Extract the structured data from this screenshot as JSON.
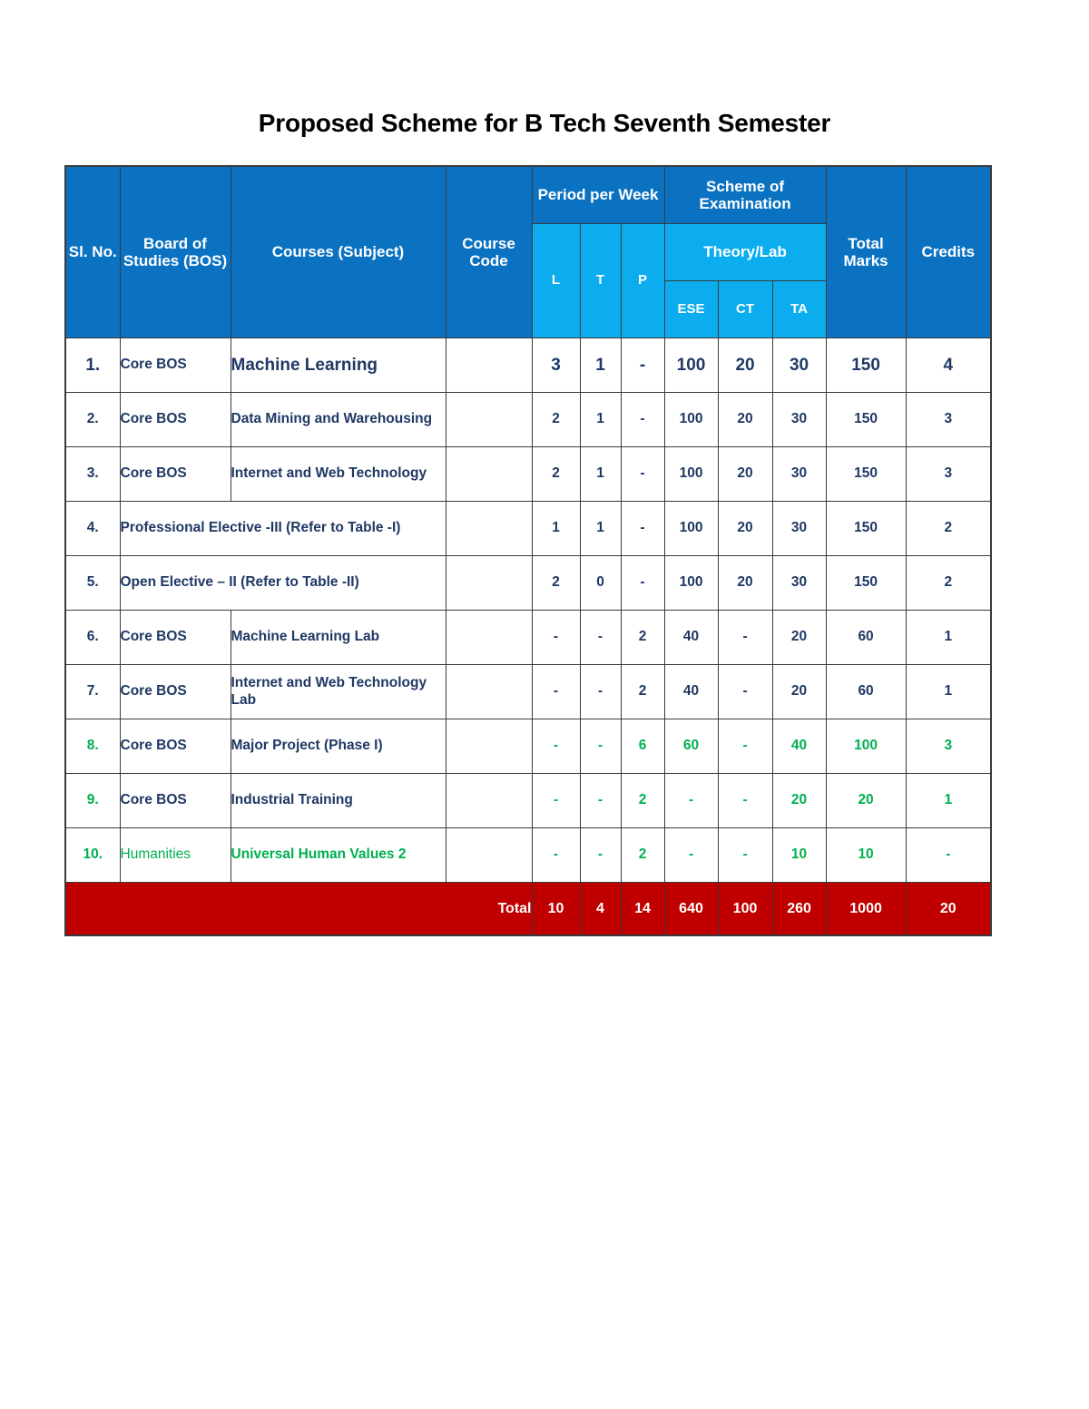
{
  "document": {
    "title": "Proposed Scheme for B Tech Seventh Semester"
  },
  "colors": {
    "header_dark_blue": "#0B72C1",
    "header_light_blue": "#0BADEE",
    "total_row_red": "#C00000",
    "body_text_navy": "#1F3864",
    "highlight_green": "#00B050",
    "border_gray": "#3A3A3A"
  },
  "table": {
    "header": {
      "sl_no": "Sl. No.",
      "board_of_studies": "Board of Studies (BOS)",
      "courses_subject": "Courses (Subject)",
      "course_code": "Course Code",
      "period_per_week": "Period per Week",
      "scheme_of_examination": "Scheme of Examination",
      "theory_lab": "Theory/Lab",
      "total_marks": "Total Marks",
      "credits": "Credits",
      "l": "L",
      "t": "T",
      "p": "P",
      "ese": "ESE",
      "ct": "CT",
      "ta": "TA"
    },
    "rows": [
      {
        "sl": "1.",
        "bos": "Core BOS",
        "course": "Machine Learning",
        "code": "",
        "l": "3",
        "t": "1",
        "p": "-",
        "ese": "100",
        "ct": "20",
        "ta": "30",
        "total_marks": "150",
        "credits": "4",
        "span": false,
        "emphasis": true,
        "color": "navy",
        "bos_color": "navy"
      },
      {
        "sl": "2.",
        "bos": "Core BOS",
        "course": "Data Mining and Warehousing",
        "code": "",
        "l": "2",
        "t": "1",
        "p": "-",
        "ese": "100",
        "ct": "20",
        "ta": "30",
        "total_marks": "150",
        "credits": "3",
        "span": false,
        "emphasis": false,
        "color": "navy",
        "bos_color": "navy"
      },
      {
        "sl": "3.",
        "bos": "Core BOS",
        "course": "Internet and Web Technology",
        "code": "",
        "l": "2",
        "t": "1",
        "p": "-",
        "ese": "100",
        "ct": "20",
        "ta": "30",
        "total_marks": "150",
        "credits": "3",
        "span": false,
        "emphasis": false,
        "color": "navy",
        "bos_color": "navy"
      },
      {
        "sl": "4.",
        "bos": "",
        "course": "Professional Elective -III (Refer to Table -I)",
        "code": "",
        "l": "1",
        "t": "1",
        "p": "-",
        "ese": "100",
        "ct": "20",
        "ta": "30",
        "total_marks": "150",
        "credits": "2",
        "span": true,
        "emphasis": false,
        "color": "navy",
        "bos_color": "navy"
      },
      {
        "sl": "5.",
        "bos": "",
        "course": "Open Elective – II (Refer to Table -II)",
        "code": "",
        "l": "2",
        "t": "0",
        "p": "-",
        "ese": "100",
        "ct": "20",
        "ta": "30",
        "total_marks": "150",
        "credits": "2",
        "span": true,
        "emphasis": false,
        "color": "navy",
        "bos_color": "navy"
      },
      {
        "sl": "6.",
        "bos": "Core BOS",
        "course": "Machine Learning Lab",
        "code": "",
        "l": "-",
        "t": "-",
        "p": "2",
        "ese": "40",
        "ct": "-",
        "ta": "20",
        "total_marks": "60",
        "credits": "1",
        "span": false,
        "emphasis": false,
        "color": "navy",
        "bos_color": "navy"
      },
      {
        "sl": "7.",
        "bos": "Core BOS",
        "course": "Internet and Web Technology Lab",
        "code": "",
        "l": "-",
        "t": "-",
        "p": "2",
        "ese": "40",
        "ct": "-",
        "ta": "20",
        "total_marks": "60",
        "credits": "1",
        "span": false,
        "emphasis": false,
        "color": "navy",
        "bos_color": "navy"
      },
      {
        "sl": "8.",
        "bos": "Core BOS",
        "course": "Major Project (Phase I)",
        "code": "",
        "l": "-",
        "t": "-",
        "p": "6",
        "ese": "60",
        "ct": "-",
        "ta": "40",
        "total_marks": "100",
        "credits": "3",
        "span": false,
        "emphasis": false,
        "color": "green",
        "sl_color": "green",
        "course_color": "navy",
        "bos_color": "navy"
      },
      {
        "sl": "9.",
        "bos": "Core BOS",
        "course": "Industrial Training",
        "code": "",
        "l": "-",
        "t": "-",
        "p": "2",
        "ese": "-",
        "ct": "-",
        "ta": "20",
        "total_marks": "20",
        "credits": "1",
        "span": false,
        "emphasis": false,
        "color": "green",
        "sl_color": "green",
        "course_color": "navy",
        "bos_color": "navy"
      },
      {
        "sl": "10.",
        "bos": "Humanities",
        "course": "Universal Human Values 2",
        "code": "",
        "l": "-",
        "t": "-",
        "p": "2",
        "ese": "-",
        "ct": "-",
        "ta": "10",
        "total_marks": "10",
        "credits": "-",
        "span": false,
        "emphasis": false,
        "color": "green",
        "sl_color": "green",
        "course_color": "green",
        "bos_color": "green-light"
      }
    ],
    "total_row": {
      "label": "Total",
      "l": "10",
      "t": "4",
      "p": "14",
      "ese": "640",
      "ct": "100",
      "ta": "260",
      "total_marks": "1000",
      "credits": "20"
    }
  }
}
